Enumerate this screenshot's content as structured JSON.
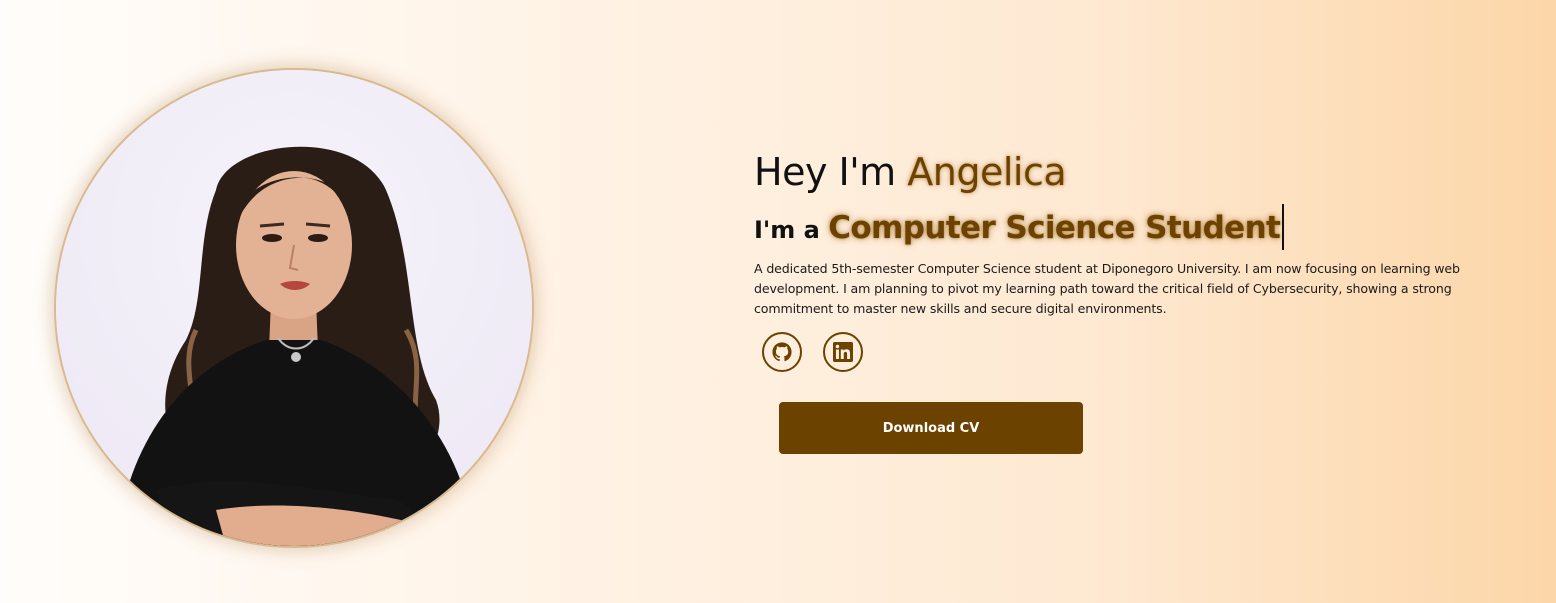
{
  "hero": {
    "greeting_prefix": "Hey I'm ",
    "name": "Angelica",
    "role_prefix": "I'm a ",
    "role": "Computer Science Student",
    "bio": "A dedicated 5th-semester Computer Science student at Diponegoro University. I am now focusing on learning web development. I am planning to pivot my learning path toward the critical field of Cybersecurity, showing a strong commitment to master new skills and secure digital environments.",
    "download_label": "Download CV"
  },
  "socials": [
    {
      "icon": "github-icon"
    },
    {
      "icon": "linkedin-icon"
    }
  ],
  "colors": {
    "accent": "#6b4200",
    "button_bg": "#6b4200",
    "button_text": "#ffffff",
    "background_start": "#fffdfb",
    "background_end": "#fcd6a8"
  }
}
